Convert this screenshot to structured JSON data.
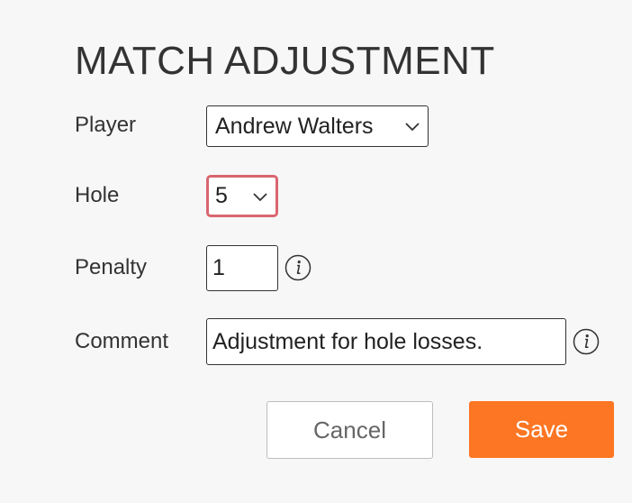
{
  "dialog": {
    "title": "MATCH ADJUSTMENT",
    "fields": {
      "player": {
        "label": "Player",
        "value": "Andrew Walters"
      },
      "hole": {
        "label": "Hole",
        "value": "5",
        "state": "invalid"
      },
      "penalty": {
        "label": "Penalty",
        "value": "1"
      },
      "comment": {
        "label": "Comment",
        "value": "Adjustment for hole losses."
      }
    },
    "buttons": {
      "cancel": "Cancel",
      "save": "Save"
    }
  },
  "colors": {
    "background": "#f7f7f7",
    "text": "#333333",
    "invalid_border": "#d9666f",
    "save_button": "#fc7623",
    "cancel_border": "#bdbdbd"
  },
  "icons": {
    "dropdown": "chevron-down-icon",
    "info": "info-icon"
  }
}
